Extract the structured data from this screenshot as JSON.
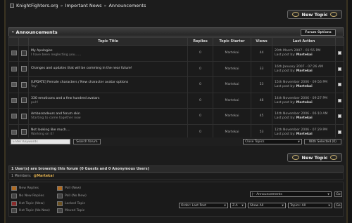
{
  "breadcrumb": {
    "site": "KnightFighters.org",
    "section": "Important News",
    "forum": "Announcements",
    "separator": "»"
  },
  "new_topic_label": "New Topic",
  "forum": {
    "title": "Announcements",
    "options_label": "Forum Options"
  },
  "columns": [
    "Topic Title",
    "Replies",
    "Topic Starter",
    "Views",
    "Last Action"
  ],
  "last_by_prefix": "Last post by:",
  "topics": [
    {
      "title": "My Apologies",
      "subtitle": "I have been neglecting you......",
      "replies": "0",
      "starter": "Martekai",
      "views": "44",
      "date": "20th March 2007 - 01:55 PM",
      "author": "Martekai"
    },
    {
      "title": "Changes and updates that will be comming in the near future!",
      "subtitle": "",
      "replies": "0",
      "starter": "Martekai",
      "views": "33",
      "date": "16th January 2007 - 07:26 AM",
      "author": "Martekai"
    },
    {
      "title": "[UPDATE] Female characters / New character avatar options",
      "subtitle": "Yay!",
      "replies": "0",
      "starter": "Martekai",
      "views": "53",
      "date": "15th November 2006 - 09:56 PM",
      "author": "Martekai"
    },
    {
      "title": "330 emoticons and a few hundred avatars",
      "subtitle": "puh!",
      "replies": "0",
      "starter": "Martekai",
      "views": "48",
      "date": "14th November 2006 - 09:27 PM",
      "author": "Martekai"
    },
    {
      "title": "Ambassadeurs and forum skin",
      "subtitle": "Starting to come together now",
      "replies": "0",
      "starter": "Martekai",
      "views": "45",
      "date": "14th November 2006 - 06:10 AM",
      "author": "Martekai"
    },
    {
      "title": "Not looking like much....",
      "subtitle": "Working on it!",
      "replies": "0",
      "starter": "Martekai",
      "views": "53",
      "date": "12th November 2006 - 07:29 PM",
      "author": "Martekai"
    }
  ],
  "search": {
    "keywords_placeholder": "Enter Keywords",
    "search_button": "Search forum",
    "close_topics": "Close Topics",
    "with_selected": "With Selected (0)"
  },
  "online": {
    "header": "1 User(s) are browsing this forum (0 Guests and 0 Anonymous Users)",
    "members_label": "1 Members:",
    "member": "@Martekai"
  },
  "legend": {
    "new_replies": "New Replies",
    "no_new_replies": "No New Replies",
    "hot_topic_new": "Hot Topic (New)",
    "hot_topic_no_new": "Hot Topic (No New)",
    "poll_new": "Poll (New)",
    "poll_no_new": "Poll (No New)",
    "locked_topic": "Locked Topic",
    "moved_topic": "Moved Topic"
  },
  "jump": {
    "forum_select": "|-- Announcements",
    "go": "Go"
  },
  "sort": {
    "order": "Order: Last Post",
    "direction": "Z-A",
    "show": "Show All",
    "topics": "Topics: All",
    "go": "Go"
  },
  "colors": {
    "accent_member": "#e0b050",
    "background": "#1c1c1c",
    "header_bar": "#2a2a2a"
  }
}
